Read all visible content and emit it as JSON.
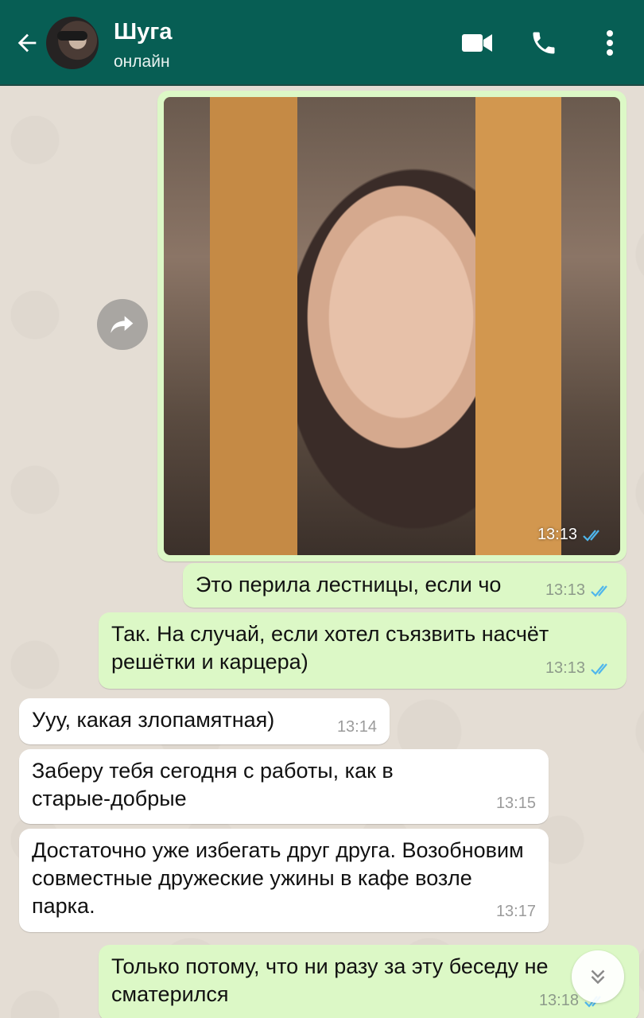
{
  "header": {
    "contact_name": "Шуга",
    "contact_status": "онлайн",
    "icons": [
      "back-arrow-icon",
      "video-call-icon",
      "phone-icon",
      "more-vertical-icon"
    ],
    "background_color": "#075e54"
  },
  "chat": {
    "image_message": {
      "time": "13:13",
      "status": "read"
    },
    "messages": [
      {
        "direction": "out",
        "text": "Это перила лестницы, если чо",
        "time": "13:13",
        "status": "read"
      },
      {
        "direction": "out",
        "text": "Так. На случай, если хотел съязвить насчёт решётки и карцера)",
        "time": "13:13",
        "status": "read"
      },
      {
        "direction": "in",
        "text": "Ууу, какая злопамятная)",
        "time": "13:14"
      },
      {
        "direction": "in",
        "text": "Заберу тебя сегодня с работы, как в старые-добрые",
        "time": "13:15"
      },
      {
        "direction": "in",
        "text": "Достаточно уже избегать друг друга. Возобновим совместные дружеские ужины в кафе возле парка.",
        "time": "13:17"
      },
      {
        "direction": "out",
        "text": "Только потому, что ни разу за эту беседу не сматерился",
        "time": "13:18",
        "status": "read"
      }
    ],
    "colors": {
      "outgoing": "#dcf8c6",
      "incoming": "#ffffff",
      "read_ticks": "#4fb6ec"
    }
  }
}
